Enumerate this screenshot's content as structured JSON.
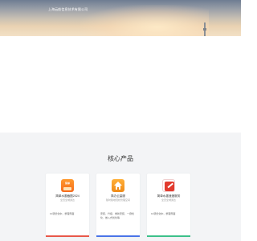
{
  "header": {
    "company_name": "上海云舫信息技术有限公司"
  },
  "products": {
    "title": "核心产品",
    "cards": [
      {
        "name": "简单水墨截图2024",
        "subtitle": "全员全域通达",
        "description": "10项优化中，整理界面",
        "icon": "app-icon-orange",
        "accent_color": "#e8584a"
      },
      {
        "name": "简办云量服",
        "subtitle": "随时随地轻松管理空间",
        "description": "安装、升级、重新安装、一键优化、嵌入式优化等",
        "icon": "house-icon",
        "accent_color": "#4a74e8"
      },
      {
        "name": "简单水墨速度服务",
        "subtitle": "全员全域通达",
        "description": "10项优化中，整理界面",
        "icon": "pen-doc-icon",
        "accent_color": "#3cc08a"
      }
    ]
  }
}
